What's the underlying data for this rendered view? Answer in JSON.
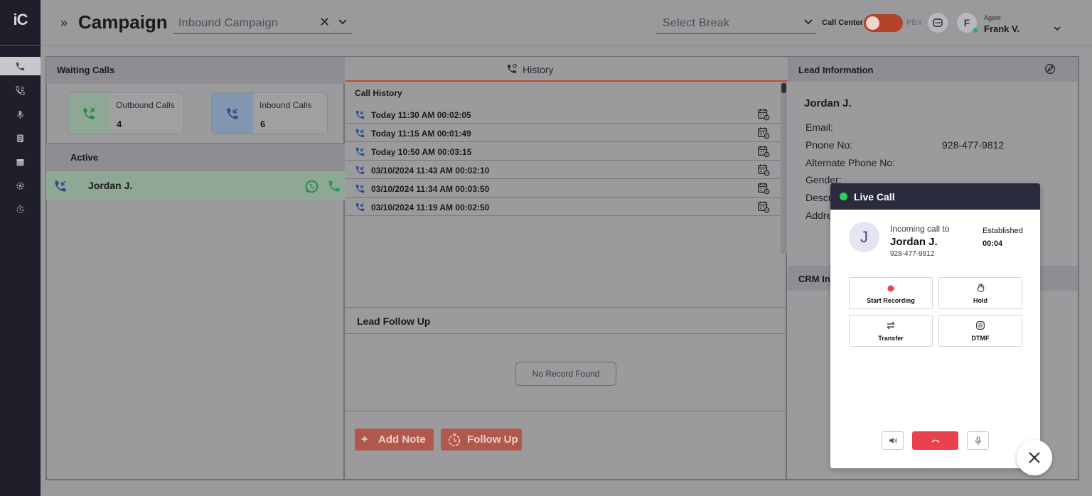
{
  "app": {
    "logo_text": "iC",
    "page_title": "Campaign",
    "expand_glyph": "»"
  },
  "header": {
    "campaign_select": {
      "value": "Inbound Campaign"
    },
    "break_select": {
      "placeholder": "Select Break"
    },
    "mode_left_label": "Call Center",
    "mode_right_label": "PBX",
    "agent": {
      "initial": "F",
      "role": "Agent",
      "name": "Frank V.",
      "status_color": "#1db34a"
    }
  },
  "sidebar": {
    "items": [
      {
        "name": "phone-icon",
        "active": true
      },
      {
        "name": "call-list-icon"
      },
      {
        "name": "microphone-icon"
      },
      {
        "name": "clipboard-icon"
      },
      {
        "name": "calendar-icon"
      },
      {
        "name": "settings-icon"
      },
      {
        "name": "follow-up-icon"
      }
    ]
  },
  "waiting": {
    "title": "Waiting Calls",
    "outbound": {
      "label": "Outbound Calls",
      "count": "4"
    },
    "inbound": {
      "label": "Inbound Calls",
      "count": "6"
    },
    "active_title": "Active",
    "active_call": {
      "name": "Jordan J."
    }
  },
  "history": {
    "tab_label": "History",
    "list_title": "Call History",
    "rows": [
      "Today 11:30 AM 00:02:05",
      "Today 11:15 AM 00:01:49",
      "Today 10:50 AM 00:03:15",
      "03/10/2024 11:43 AM 00:02:10",
      "03/10/2024 11:34 AM 00:03:50",
      "03/10/2024 11:19 AM 00:02:50"
    ]
  },
  "follow_up": {
    "title": "Lead Follow Up",
    "empty": "No Record Found",
    "add_note": "Add Note",
    "follow_up_btn": "Follow Up",
    "add_glyph": "+"
  },
  "lead": {
    "title": "Lead Information",
    "name": "Jordan J.",
    "fields": {
      "email": "Email:",
      "phone": "Pnone No:",
      "phone_value": "928-477-9812",
      "alt_phone": "Alternate Phone No:",
      "gender": "Gender:",
      "description": "Descr",
      "address": "Addre"
    },
    "crm_title": "CRM In"
  },
  "live_call": {
    "title": "Live Call",
    "avatar_initial": "J",
    "incoming_text": "Incoming call to",
    "caller": "Jordan J.",
    "caller_number": "928-477-9812",
    "status": "Established",
    "timer": "00:04",
    "actions": {
      "record": "Start Recording",
      "hold": "Hold",
      "transfer": "Transfer",
      "dtmf": "DTMF"
    }
  },
  "colors": {
    "accent_red": "#e8424d",
    "live_green": "#2fd05c",
    "toggle": "#b2442a"
  }
}
